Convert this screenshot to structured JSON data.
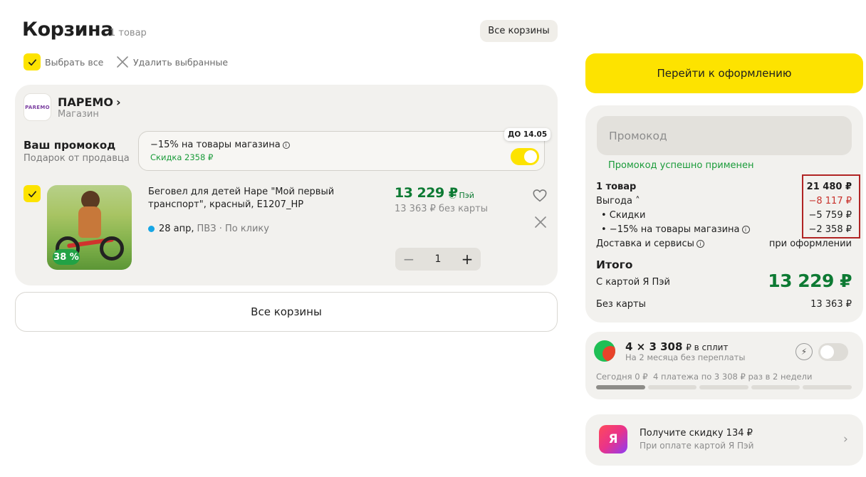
{
  "header": {
    "title": "Корзина",
    "item_count": "1 товар",
    "all_carts_label": "Все корзины"
  },
  "selection": {
    "select_all_label": "Выбрать все",
    "delete_selected_label": "Удалить выбранные"
  },
  "shop": {
    "logo_text": "PAREMO",
    "name": "ПАРЕМО",
    "type": "Магазин",
    "promo": {
      "title": "Ваш промокод",
      "subtitle": "Подарок от продавца",
      "offer_title": "−15% на товары магазина",
      "offer_discount": "Скидка 2358 ₽",
      "valid_until": "ДО 14.05",
      "enabled": true
    },
    "item": {
      "title": "Беговел для детей Hape \"Мой первый транспорт\", красный, E1207_HP",
      "discount_badge": "38 %",
      "price": "13 229 ₽",
      "pay_label": "Пэй",
      "price_without_card": "13 363 ₽ без карты",
      "delivery_date": "28 апр,",
      "delivery_info": "ПВЗ · По клику",
      "quantity": "1"
    }
  },
  "bottom_all_carts_label": "Все корзины",
  "sidebar": {
    "checkout_label": "Перейти к оформлению",
    "promo_placeholder": "Промокод",
    "promo_applied": "Промокод успешно применен",
    "summary": {
      "items_label": "1 товар",
      "items_value": "21 480 ₽",
      "benefit_label": "Выгода",
      "benefit_value": "−8 117 ₽",
      "discounts_label": "• Скидки",
      "discounts_value": "−5 759 ₽",
      "promo_label": "• −15% на товары магазина",
      "promo_value": "−2 358 ₽",
      "delivery_label": "Доставка и сервисы",
      "delivery_value": "при оформлении",
      "total_label": "Итого",
      "with_card_label": "С картой Я Пэй",
      "total_value": "13 229 ₽",
      "without_card_label": "Без карты",
      "without_card_value": "13 363 ₽"
    },
    "split": {
      "title_amount": "4 × 3 308",
      "title_suffix": "₽ в сплит",
      "subtitle": "На 2 месяца без переплаты",
      "today": "Сегодня 0 ₽",
      "plan": "4 платежа по 3 308 ₽ раз в 2 недели",
      "enabled": false
    },
    "ya_pay": {
      "logo": "Я",
      "title": "Получите скидку 134 ₽",
      "subtitle": "При оплате картой Я Пэй"
    }
  },
  "colors": {
    "accent_yellow": "#fde300",
    "price_green": "#0d7a33",
    "success_green": "#1a9b3a",
    "discount_red": "#c8312b",
    "card_bg": "#f2f1ee"
  }
}
